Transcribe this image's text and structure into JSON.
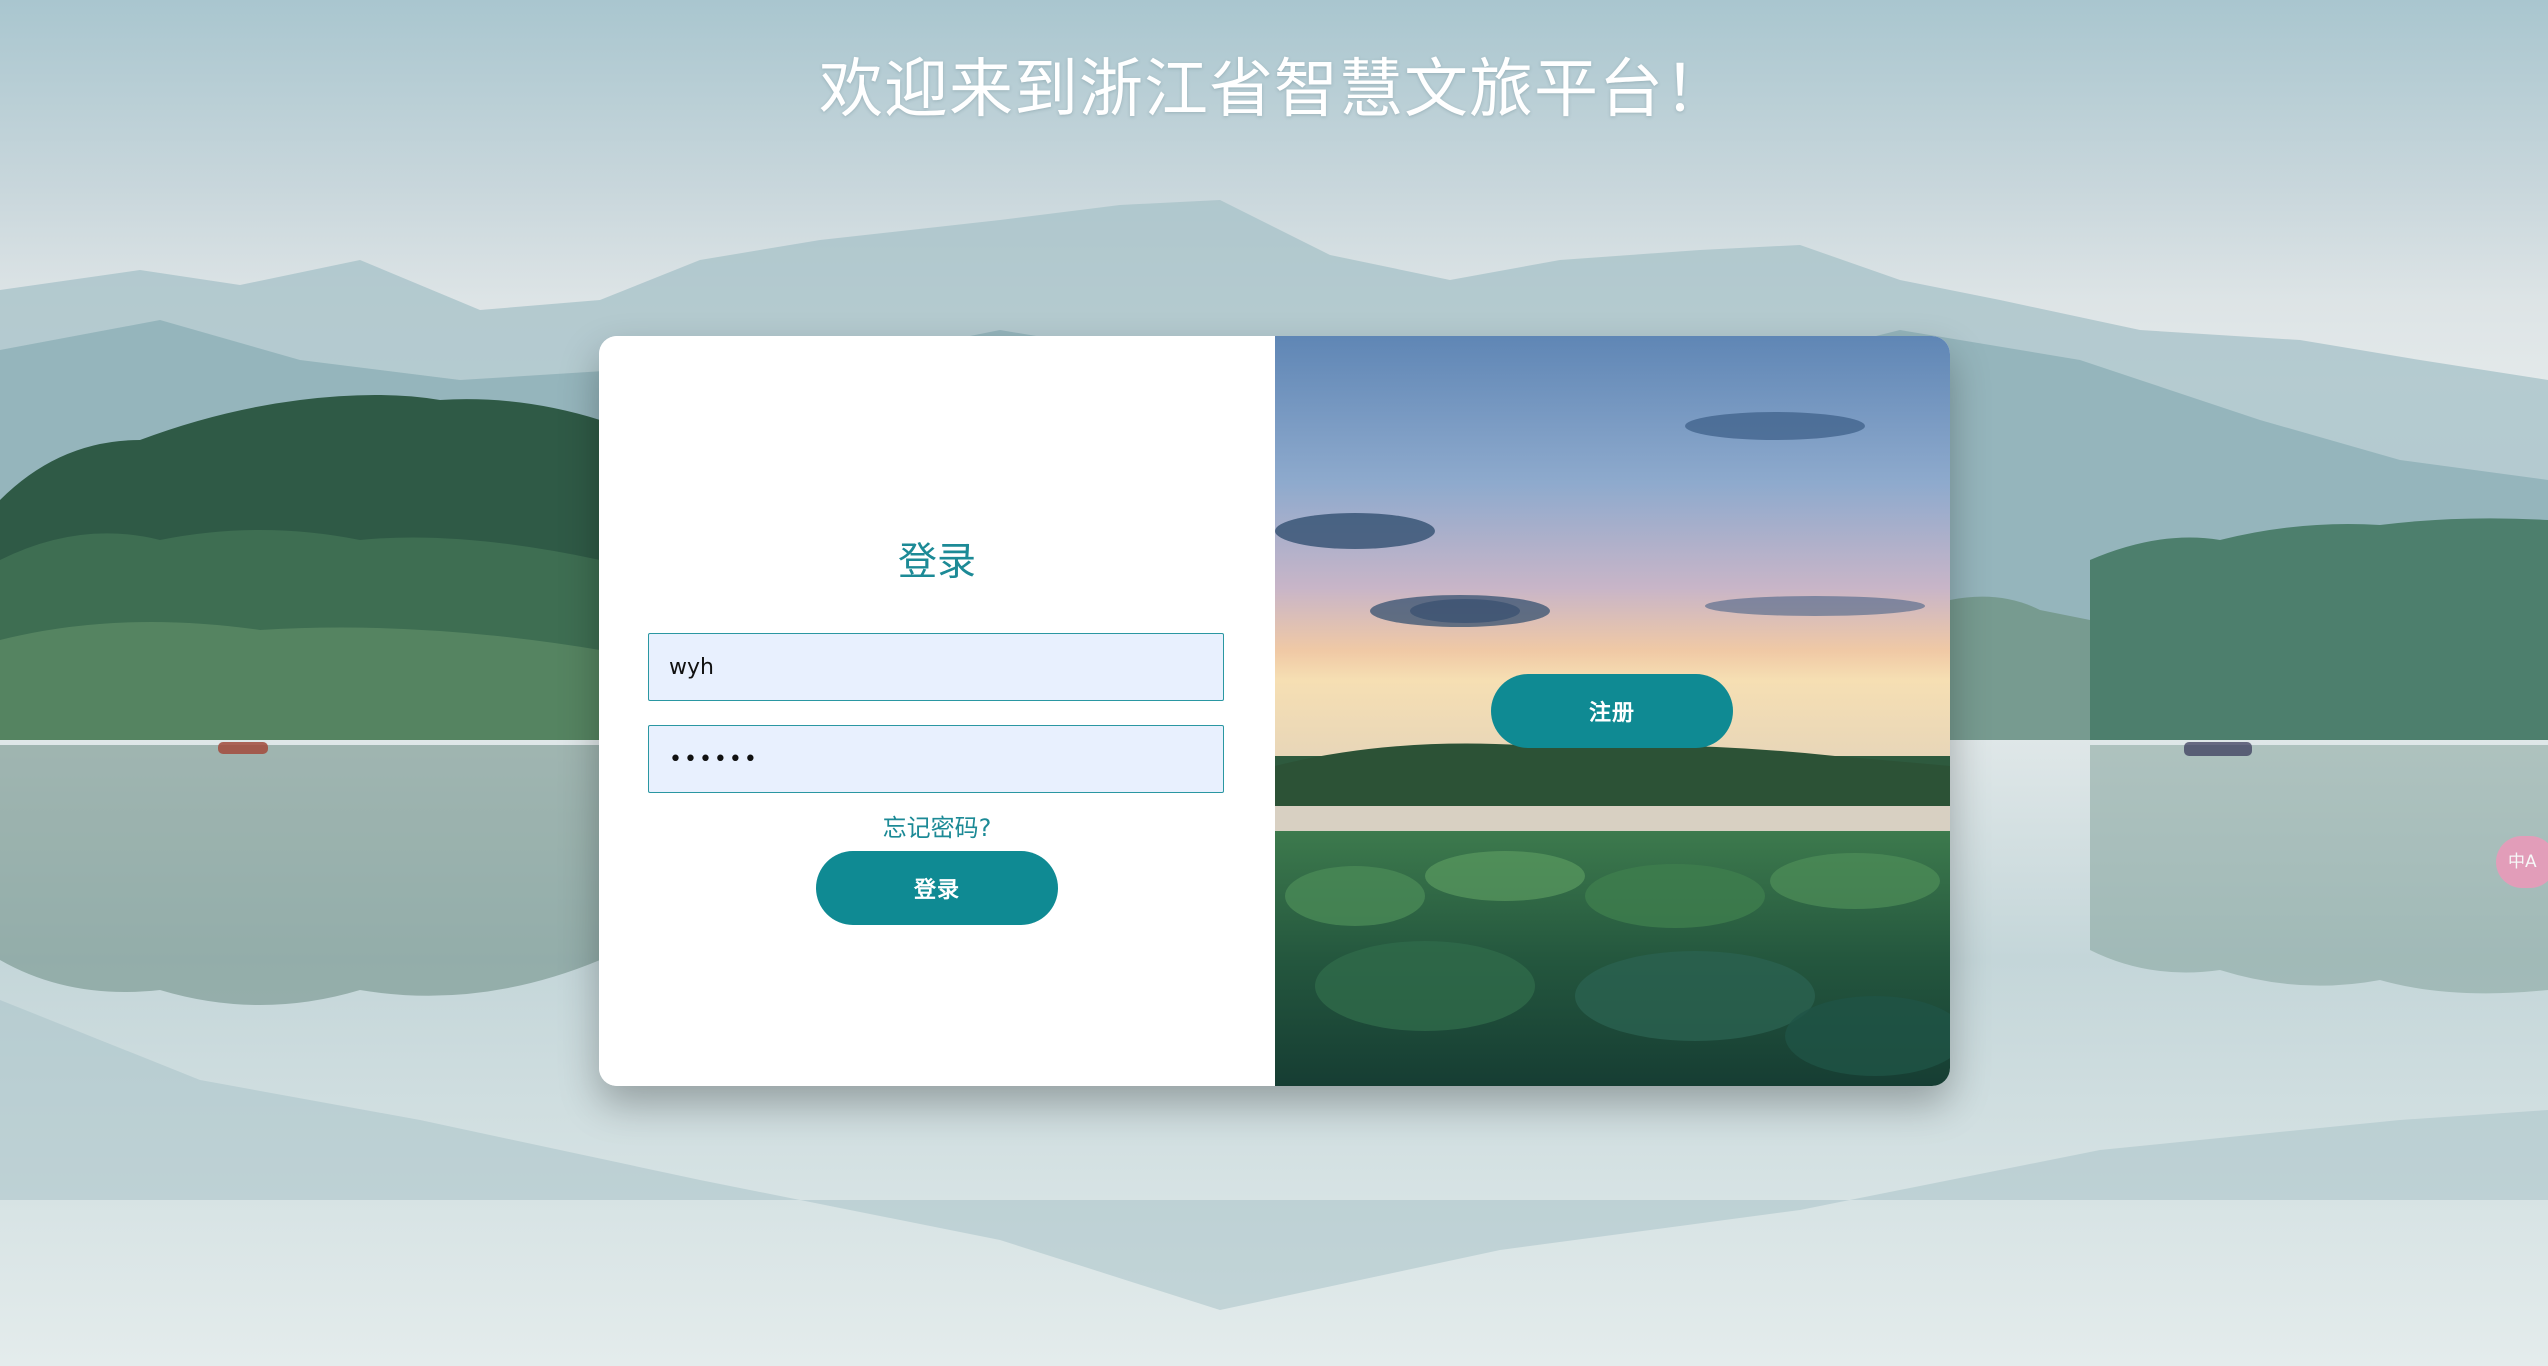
{
  "page": {
    "title": "欢迎来到浙江省智慧文旅平台！"
  },
  "login": {
    "title": "登录",
    "username_value": "wyh",
    "password_value": "••••••",
    "forgot_password": "忘记密码?",
    "submit_label": "登录"
  },
  "register": {
    "button_label": "注册"
  },
  "toolbar": {
    "translate_icon": "translate-icon",
    "translate_glyph": "中A"
  },
  "colors": {
    "accent": "#0f8a93",
    "title_teal": "#1c8a96",
    "input_bg": "#e8f0fe"
  }
}
